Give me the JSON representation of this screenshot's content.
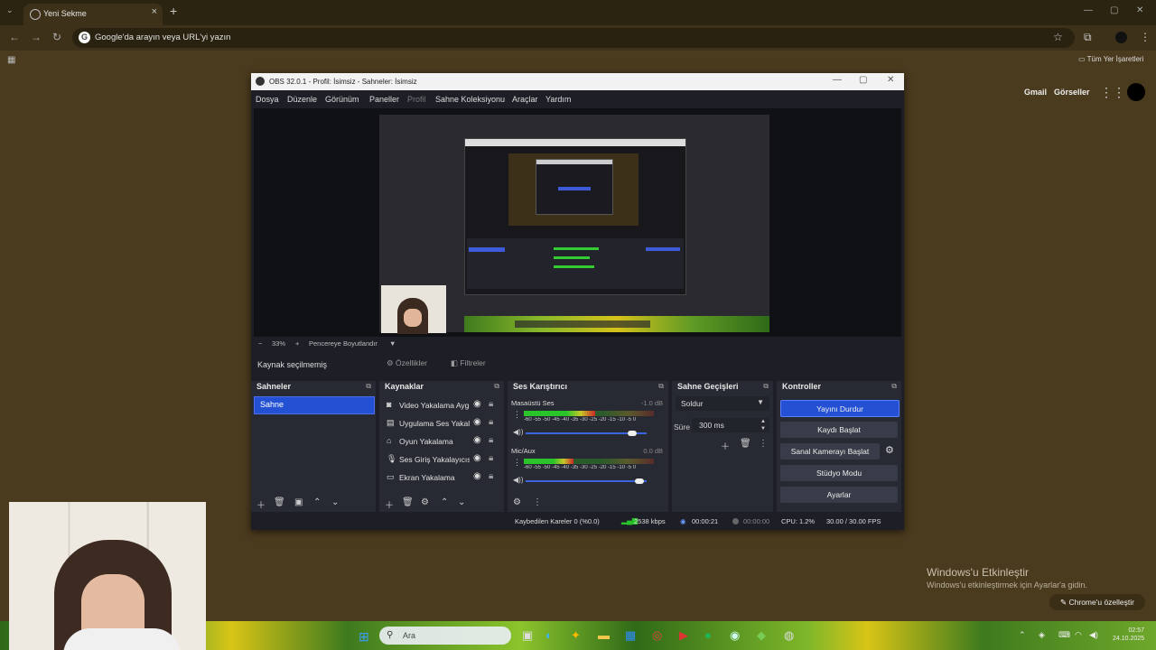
{
  "browser": {
    "tab_title": "Yeni Sekme",
    "omnibox_placeholder": "Google'da arayın veya URL'yi yazın",
    "bookmarks_all": "Tüm Yer İşaretleri"
  },
  "ntp": {
    "gmail": "Gmail",
    "images": "Görseller",
    "activate_title": "Windows'u Etkinleştir",
    "activate_sub": "Windows'u etkinleştirmek için Ayarlar'a gidin.",
    "customize_label": "Chrome'u özelleştir"
  },
  "obs": {
    "title": "OBS 32.0.1 - Profil: İsimsiz - Sahneler: İsimsiz",
    "menu": [
      "Dosya",
      "Düzenle",
      "Görünüm",
      "Paneller",
      "Profil",
      "Sahne Koleksiyonu",
      "Araçlar",
      "Yardım"
    ],
    "preview_zoom": "33%",
    "preview_fit": "Pencereye Boyutlandır",
    "source_bar": {
      "no_source": "Kaynak seçilmemiş",
      "properties": "Özellikler",
      "filters": "Filtreler"
    },
    "scenes": {
      "title": "Sahneler",
      "items": [
        "Sahne"
      ]
    },
    "sources": {
      "title": "Kaynaklar",
      "items": [
        {
          "icon": "monitor-icon",
          "name": "Video Yakalama Aygıtı"
        },
        {
          "icon": "window-icon",
          "name": "Uygulama Ses Yakalama"
        },
        {
          "icon": "gamepad-icon",
          "name": "Oyun Yakalama"
        },
        {
          "icon": "mic-icon",
          "name": "Ses Giriş Yakalayıcısı"
        },
        {
          "icon": "display-icon",
          "name": "Ekran Yakalama"
        }
      ]
    },
    "mixer": {
      "title": "Ses Karıştırıcı",
      "ticks": "-60 -55 -50 -45 -40 -35 -30 -25 -20 -15 -10 -5 0",
      "channels": [
        {
          "name": "Masaüstü Ses",
          "db": "-1.0 dB",
          "level": 0.55,
          "volume": 0.92
        },
        {
          "name": "Mic/Aux",
          "db": "0.0 dB",
          "level": 0.38,
          "volume": 0.98
        }
      ]
    },
    "transitions": {
      "title": "Sahne Geçişleri",
      "selected": "Soldur",
      "duration_label": "Süre",
      "duration_value": "300 ms"
    },
    "controls": {
      "title": "Kontroller",
      "stop_stream": "Yayını Durdur",
      "start_record": "Kaydı Başlat",
      "virtual_cam": "Sanal Kamerayı Başlat",
      "studio_mode": "Stüdyo Modu",
      "settings": "Ayarlar"
    },
    "status": {
      "dropped": "Kaybedilen Kareler 0 (%0.0)",
      "bitrate": "2538 kbps",
      "stream_time": "00:00:21",
      "record_time": "00:00:00",
      "cpu": "CPU: 1.2%",
      "fps": "30.00 / 30.00 FPS"
    },
    "colors": {
      "accent": "#2451d4",
      "bg": "#1e1f26",
      "dock": "#272a33"
    }
  },
  "taskbar": {
    "search_placeholder": "Ara",
    "clock_time": "02:57",
    "clock_date": "24.10.2025"
  }
}
